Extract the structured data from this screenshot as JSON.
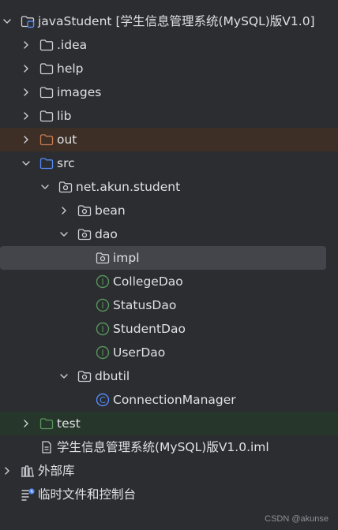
{
  "tree": {
    "root": {
      "name": "javaStudent",
      "title": "[学生信息管理系统(MySQL)版V1.0]"
    },
    "folders": {
      "idea": ".idea",
      "help": "help",
      "images": "images",
      "lib": "lib",
      "out": "out",
      "src": "src",
      "package": "net.akun.student",
      "bean": "bean",
      "dao": "dao",
      "impl": "impl",
      "dbutil": "dbutil",
      "test": "test"
    },
    "interfaces": [
      "CollegeDao",
      "StatusDao",
      "StudentDao",
      "UserDao"
    ],
    "classes": {
      "connection_manager": "ConnectionManager"
    },
    "iml_file": "学生信息管理系统(MySQL)版V1.0.iml",
    "external_libraries": "外部库",
    "scratches_consoles": "临时文件和控制台",
    "interface_glyph": "I",
    "class_glyph": "C"
  },
  "colors": {
    "background": "#2b2d30",
    "text": "#dfe1e5",
    "folder_stroke": "#ced0d6",
    "src_folder": "#548af7",
    "out_folder": "#c67d54",
    "test_folder": "#57965c",
    "interface_icon": "#57965c",
    "class_icon": "#548af7",
    "excluded_row_bg": "#3d2f26",
    "test_row_bg": "#27362a",
    "selected_row_bg": "#43454a"
  },
  "watermark": "CSDN @akunse"
}
